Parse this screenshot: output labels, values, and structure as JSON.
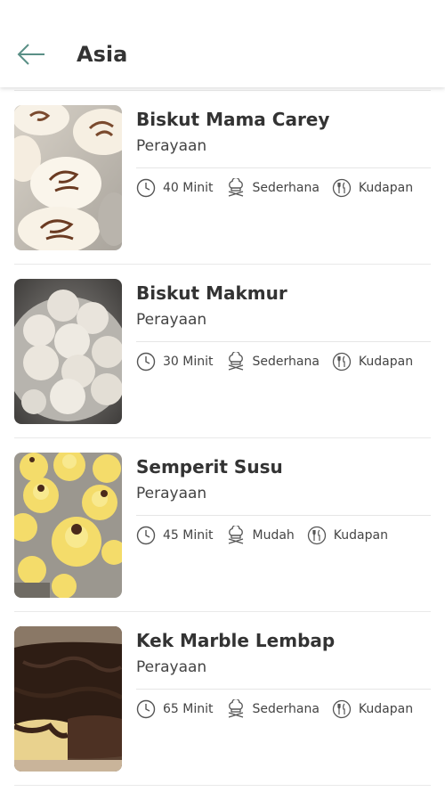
{
  "header": {
    "title": "Asia"
  },
  "recipes": [
    {
      "title": "Biskut Mama Carey",
      "category": "Perayaan",
      "time": "40 Minit",
      "difficulty": "Sederhana",
      "type": "Kudapan"
    },
    {
      "title": "Biskut Makmur",
      "category": "Perayaan",
      "time": "30 Minit",
      "difficulty": "Sederhana",
      "type": "Kudapan"
    },
    {
      "title": "Semperit Susu",
      "category": "Perayaan",
      "time": "45 Minit",
      "difficulty": "Mudah",
      "type": "Kudapan"
    },
    {
      "title": "Kek Marble Lembap",
      "category": "Perayaan",
      "time": "65 Minit",
      "difficulty": "Sederhana",
      "type": "Kudapan"
    }
  ],
  "icons": {
    "back": "arrow-left-icon",
    "time": "clock-icon",
    "difficulty": "chef-hat-icon",
    "type": "utensils-icon"
  },
  "colors": {
    "accent": "#5a8f86",
    "text": "#333333",
    "divider": "#e9e9e9"
  }
}
